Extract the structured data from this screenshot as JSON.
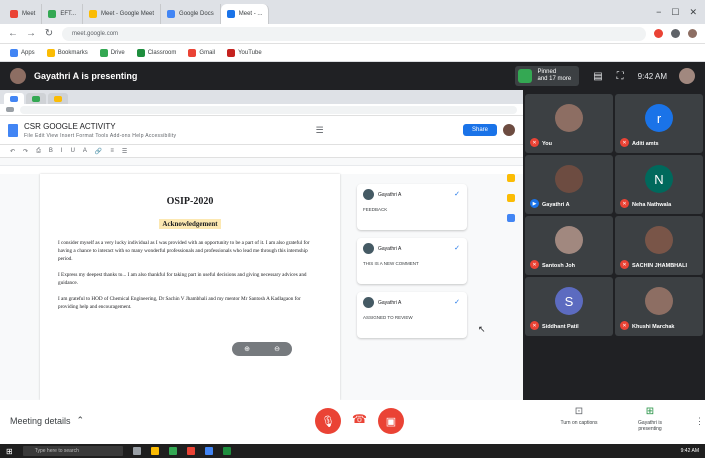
{
  "browser": {
    "tabs": [
      {
        "label": "Meet",
        "color": "#ea4335",
        "active": false
      },
      {
        "label": "EFT...",
        "color": "#34a853",
        "active": false
      },
      {
        "label": "Meet - Google Meet",
        "color": "#fbbc04",
        "active": false
      },
      {
        "label": "Google Docs",
        "color": "#4285f4",
        "active": false
      },
      {
        "label": "Meet - ...",
        "color": "#1a73e8",
        "active": true
      }
    ],
    "url": "meet.google.com",
    "bookmarks": [
      "Apps",
      "Bookmarks",
      "Drive",
      "Classroom",
      "Gmail",
      "YouTube"
    ]
  },
  "meet": {
    "presenter_label": "Gayathri A is presenting",
    "pin_line1": "Pinned",
    "pin_line2": "and 17 more",
    "clock": "9:42 AM"
  },
  "docs": {
    "title": "CSR GOOGLE ACTIVITY",
    "menu": "File  Edit  View  Insert  Format  Tools  Add-ons  Help  Accessibility",
    "share": "Share",
    "heading": "OSIP-2020",
    "subheading": "Acknowledgement",
    "para1": "I consider myself as a very lucky individual as I was provided with an opportunity to be a part of it. I am also grateful for having a chance to interact with so many wonderful professionals and professionals who lead me through this internship period.",
    "para2": "I Express my deepest thanks to... I am also thankful for taking part in useful decisions and giving necessary advices and guidance.",
    "para3": "I am grateful to HOD of Chemical Engineering, Dr Sachin V Jhambhali and my mentor Mr Santosh A Kadlagaon for providing help and encouragement.",
    "comments": [
      {
        "name": "Gayathri A",
        "text": "FEEDBACK"
      },
      {
        "name": "Gayathri A",
        "text": "THIS IS A NEW COMMENT"
      },
      {
        "name": "Gayathri A",
        "text": "ASSIGNED TO REVIEW"
      }
    ]
  },
  "participants": [
    {
      "name": "You",
      "initial": "",
      "color": "#8d6e63"
    },
    {
      "name": "Aditi amts",
      "initial": "r",
      "color": "#1a73e8"
    },
    {
      "name": "Gayathri A",
      "initial": "",
      "color": "#6d4c41"
    },
    {
      "name": "Neha Nathwala",
      "initial": "N",
      "color": "#00695c"
    },
    {
      "name": "Santosh Joh",
      "initial": "",
      "color": "#a1887f"
    },
    {
      "name": "SACHIN JHAMBHALI",
      "initial": "",
      "color": "#795548"
    },
    {
      "name": "Siddhant Patil",
      "initial": "S",
      "color": "#5c6bc0"
    },
    {
      "name": "Khushi Marchak",
      "initial": "",
      "color": "#8d6e63"
    }
  ],
  "controls": {
    "meeting_details": "Meeting details",
    "turn_on_captions": "Turn on captions",
    "present_now": "Gayathri is presenting"
  },
  "taskbar": {
    "search": "Type here to search",
    "time": "9:42 AM"
  }
}
